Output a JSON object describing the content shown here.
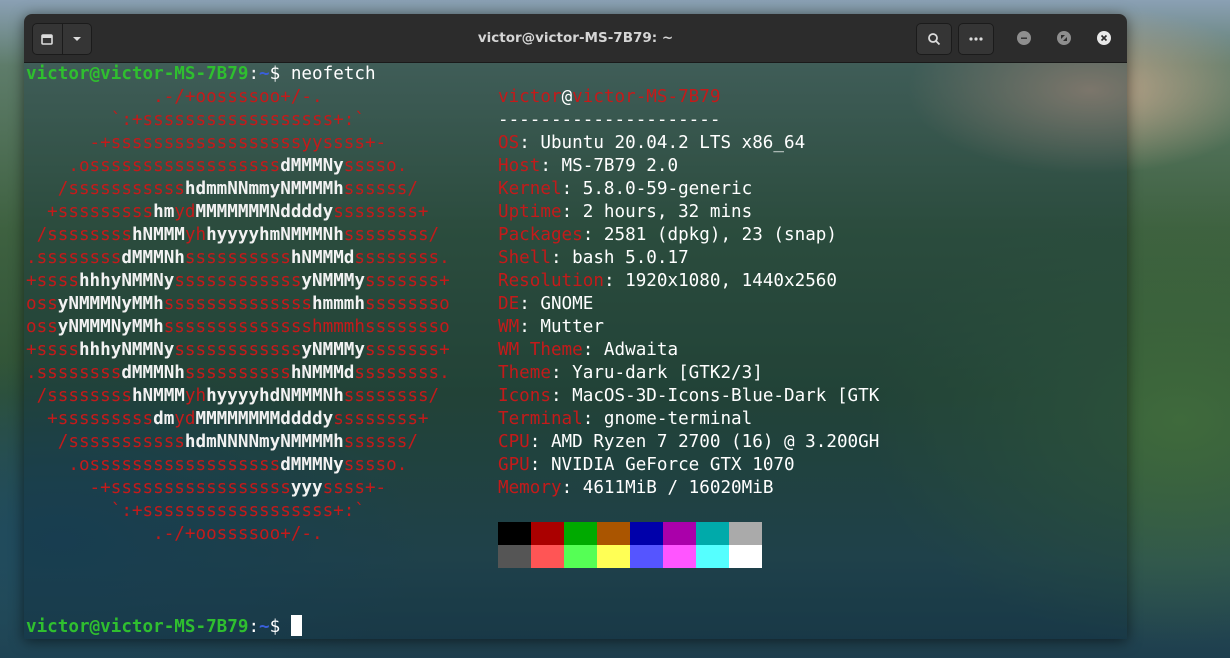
{
  "window": {
    "title": "victor@victor-MS-7B79: ~"
  },
  "icons": {
    "new_tab": "new-tab-icon",
    "menu": "chevron-down-icon",
    "search": "search-icon",
    "more": "more-icon",
    "minimize": "minimize-icon",
    "maximize": "maximize-icon",
    "close": "close-icon"
  },
  "prompt": {
    "user_host": "victor@victor-MS-7B79",
    "colon": ":",
    "path": "~",
    "dollar": "$",
    "command": " neofetch"
  },
  "logo_lines": [
    [
      [
        "r",
        "            .-/+oossssoo+/-."
      ]
    ],
    [
      [
        "r",
        "        `:+ssssssssssssssssss+:`"
      ]
    ],
    [
      [
        "r",
        "      -+ssssssssssssssssssyyssss+-"
      ]
    ],
    [
      [
        "r",
        "    .ossssssssssssssssss"
      ],
      [
        "w",
        "dMMMNy"
      ],
      [
        "r",
        "sssso."
      ]
    ],
    [
      [
        "r",
        "   /sssssssssss"
      ],
      [
        "w",
        "hdmmNNmmyNMMMMh"
      ],
      [
        "r",
        "ssssss/"
      ]
    ],
    [
      [
        "r",
        "  +sssssssss"
      ],
      [
        "w",
        "hm"
      ],
      [
        "r",
        "yd"
      ],
      [
        "w",
        "MMMMMMMNddddy"
      ],
      [
        "r",
        "ssssssss+"
      ]
    ],
    [
      [
        "r",
        " /ssssssss"
      ],
      [
        "w",
        "hNMMM"
      ],
      [
        "r",
        "yh"
      ],
      [
        "w",
        "hyyyyhmNMMMNh"
      ],
      [
        "r",
        "ssssssss/"
      ]
    ],
    [
      [
        "r",
        ".ssssssss"
      ],
      [
        "w",
        "dMMMNh"
      ],
      [
        "r",
        "ssssssssss"
      ],
      [
        "w",
        "hNMMMd"
      ],
      [
        "r",
        "ssssssss."
      ]
    ],
    [
      [
        "r",
        "+ssss"
      ],
      [
        "w",
        "hhhyNMMNy"
      ],
      [
        "r",
        "ssssssssssss"
      ],
      [
        "w",
        "yNMMMy"
      ],
      [
        "r",
        "sssssss+"
      ]
    ],
    [
      [
        "r",
        "oss"
      ],
      [
        "w",
        "yNMMMNyMMh"
      ],
      [
        "r",
        "ssssssssssssss"
      ],
      [
        "w",
        "hmmmh"
      ],
      [
        "r",
        "ssssssso"
      ]
    ],
    [
      [
        "r",
        "oss"
      ],
      [
        "w",
        "yNMMMNyMMh"
      ],
      [
        "r",
        "sssssssssssssshmmmhssssssso"
      ]
    ],
    [
      [
        "r",
        "+ssss"
      ],
      [
        "w",
        "hhhyNMMNy"
      ],
      [
        "r",
        "ssssssssssss"
      ],
      [
        "w",
        "yNMMMy"
      ],
      [
        "r",
        "sssssss+"
      ]
    ],
    [
      [
        "r",
        ".ssssssss"
      ],
      [
        "w",
        "dMMMNh"
      ],
      [
        "r",
        "ssssssssss"
      ],
      [
        "w",
        "hNMMMd"
      ],
      [
        "r",
        "ssssssss."
      ]
    ],
    [
      [
        "r",
        " /ssssssss"
      ],
      [
        "w",
        "hNMMM"
      ],
      [
        "r",
        "yh"
      ],
      [
        "w",
        "hyyyyhdNMMMNh"
      ],
      [
        "r",
        "ssssssss/"
      ]
    ],
    [
      [
        "r",
        "  +sssssssss"
      ],
      [
        "w",
        "dm"
      ],
      [
        "r",
        "yd"
      ],
      [
        "w",
        "MMMMMMMMddddy"
      ],
      [
        "r",
        "ssssssss+"
      ]
    ],
    [
      [
        "r",
        "   /sssssssssss"
      ],
      [
        "w",
        "hdmNNNNmyNMMMMh"
      ],
      [
        "r",
        "ssssss/"
      ]
    ],
    [
      [
        "r",
        "    .ossssssssssssssssss"
      ],
      [
        "w",
        "dMMMNy"
      ],
      [
        "r",
        "sssso."
      ]
    ],
    [
      [
        "r",
        "      -+sssssssssssssssss"
      ],
      [
        "w",
        "yyy"
      ],
      [
        "r",
        "ssss+-"
      ]
    ],
    [
      [
        "r",
        "        `:+ssssssssssssssssss+:`"
      ]
    ],
    [
      [
        "r",
        "            .-/+oossssoo+/-."
      ]
    ]
  ],
  "header": {
    "user": "victor",
    "at": "@",
    "host": "victor-MS-7B79",
    "separator": "---------------------"
  },
  "info": [
    {
      "label": "OS",
      "value": ": Ubuntu 20.04.2 LTS x86_64"
    },
    {
      "label": "Host",
      "value": ": MS-7B79 2.0"
    },
    {
      "label": "Kernel",
      "value": ": 5.8.0-59-generic"
    },
    {
      "label": "Uptime",
      "value": ": 2 hours, 32 mins"
    },
    {
      "label": "Packages",
      "value": ": 2581 (dpkg), 23 (snap)"
    },
    {
      "label": "Shell",
      "value": ": bash 5.0.17"
    },
    {
      "label": "Resolution",
      "value": ": 1920x1080, 1440x2560"
    },
    {
      "label": "DE",
      "value": ": GNOME"
    },
    {
      "label": "WM",
      "value": ": Mutter"
    },
    {
      "label": "WM Theme",
      "value": ": Adwaita"
    },
    {
      "label": "Theme",
      "value": ": Yaru-dark [GTK2/3]"
    },
    {
      "label": "Icons",
      "value": ": MacOS-3D-Icons-Blue-Dark [GTK"
    },
    {
      "label": "Terminal",
      "value": ": gnome-terminal"
    },
    {
      "label": "CPU",
      "value": ": AMD Ryzen 7 2700 (16) @ 3.200GH"
    },
    {
      "label": "GPU",
      "value": ": NVIDIA GeForce GTX 1070"
    },
    {
      "label": "Memory",
      "value": ": 4611MiB / 16020MiB"
    }
  ],
  "palette": {
    "normal": [
      "#000000",
      "#aa0000",
      "#00aa00",
      "#aa5500",
      "#0000aa",
      "#aa00aa",
      "#00aaaa",
      "#aaaaaa"
    ],
    "bright": [
      "#555555",
      "#ff5555",
      "#55ff55",
      "#ffff55",
      "#5555ff",
      "#ff55ff",
      "#55ffff",
      "#ffffff"
    ]
  }
}
